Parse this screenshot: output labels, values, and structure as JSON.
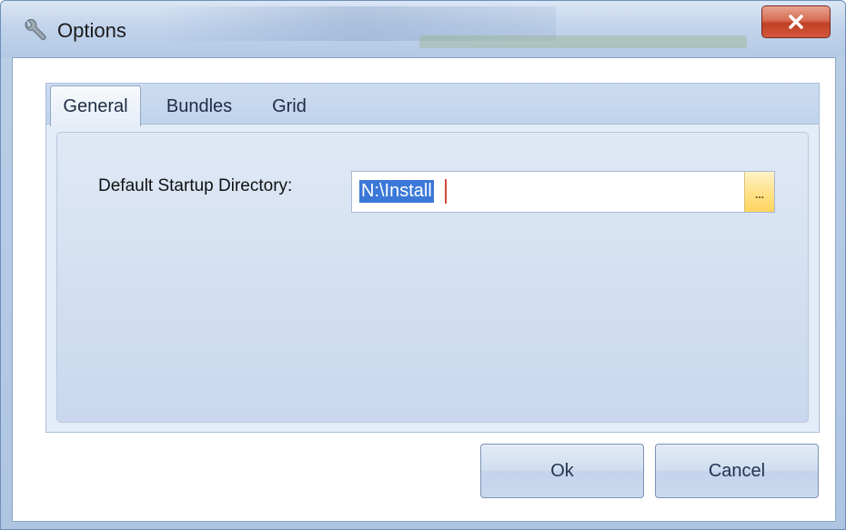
{
  "window": {
    "title": "Options",
    "icon": "wrench-icon",
    "close_icon": "close-x-icon"
  },
  "tabs": [
    {
      "label": "General",
      "active": true
    },
    {
      "label": "Bundles",
      "active": false
    },
    {
      "label": "Grid",
      "active": false
    }
  ],
  "general": {
    "startup_dir_label": "Default Startup Directory:",
    "startup_dir_value": "N:\\Install",
    "browse_label": "..."
  },
  "buttons": {
    "ok_label": "Ok",
    "cancel_label": "Cancel"
  },
  "colors": {
    "close_button": "#c7472b",
    "selection": "#3b78d8",
    "browse_button": "#ffe28c"
  }
}
